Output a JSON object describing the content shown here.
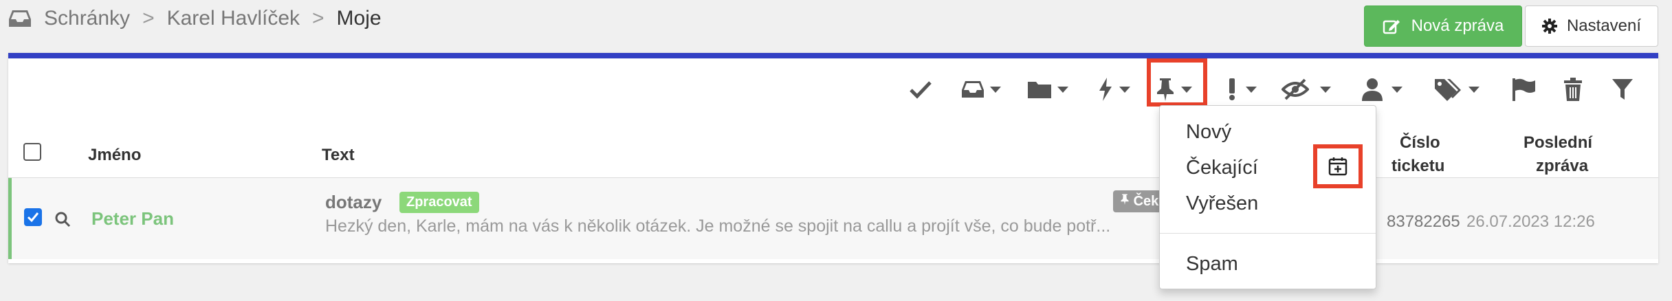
{
  "breadcrumb": {
    "items": [
      "Schránky",
      "Karel Havlíček",
      "Moje"
    ],
    "separator": ">"
  },
  "buttons": {
    "new_message": "Nová zpráva",
    "settings": "Nastavení"
  },
  "toolbar": {
    "icons": [
      "check-icon",
      "inbox-icon",
      "folder-icon",
      "bolt-icon",
      "pin-icon",
      "exclamation-icon",
      "eye-slash-icon",
      "user-icon",
      "tags-icon",
      "flag-icon",
      "trash-icon",
      "filter-icon"
    ]
  },
  "table": {
    "headers": {
      "name": "Jméno",
      "text": "Text",
      "ticket_line1": "Číslo",
      "ticket_line2": "ticketu",
      "last_line1": "Poslední",
      "last_line2": "zpráva"
    },
    "rows": [
      {
        "name": "Peter Pan",
        "subject": "dotazy",
        "badge": "Zpracovat",
        "preview": "Hezký den, Karle, mám na vás k několik otázek. Je možné se spojit na callu a projít vše, co bude potř...",
        "status_tag": "Ček",
        "ticket": "83782265",
        "last_message": "26.07.2023 12:26",
        "checked": true
      }
    ]
  },
  "dropdown": {
    "items": [
      "Nový",
      "Čekající",
      "Vyřešen",
      "Spam"
    ]
  },
  "colors": {
    "accent": "#3240c4",
    "green": "#5cb85c",
    "highlight": "#e8412a",
    "badge": "#8cd87a"
  }
}
